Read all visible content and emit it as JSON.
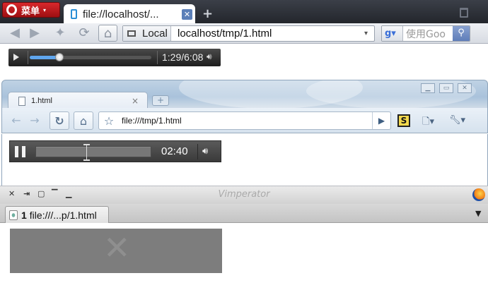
{
  "opera": {
    "menu_label": "菜单",
    "tab_title": "file://localhost/...",
    "tab_close": "✕",
    "new_tab": "+",
    "location_badge": "Local",
    "address": "localhost/tmp/1.html",
    "search_placeholder": "使用Goo",
    "player": {
      "time": "1:29/6:08",
      "progress": 0.243,
      "buffered": 0.26,
      "state": "paused"
    }
  },
  "chrome": {
    "tab_title": "1.html",
    "tab_close": "×",
    "new_tab": "+",
    "address": "file:///tmp/1.html",
    "extension_letter": "S",
    "player": {
      "time": "02:40",
      "progress": 0.44,
      "state": "playing"
    }
  },
  "firefox": {
    "app_name": "Vimperator",
    "tab_number": "1",
    "tab_title": "file:///...p/1.html",
    "video_error_glyph": "✕"
  },
  "icons": {
    "opera_logo": "opera-logo-icon",
    "back": "arrow-left-icon",
    "forward": "arrow-right-icon",
    "reload": "reload-icon",
    "home": "home-icon",
    "star": "star-icon",
    "wrench": "wrench-icon",
    "page": "page-menu-icon",
    "volume": "speaker-icon",
    "firefox_logo": "firefox-logo-icon"
  },
  "colors": {
    "opera_menu_red": "#c41a1e",
    "opera_progress_blue": "#5fa6ee",
    "chrome_frame_blue": "#a9c2db",
    "player_dark": "#2b2b2b",
    "firefox_video_gray": "#7d7d7d"
  }
}
